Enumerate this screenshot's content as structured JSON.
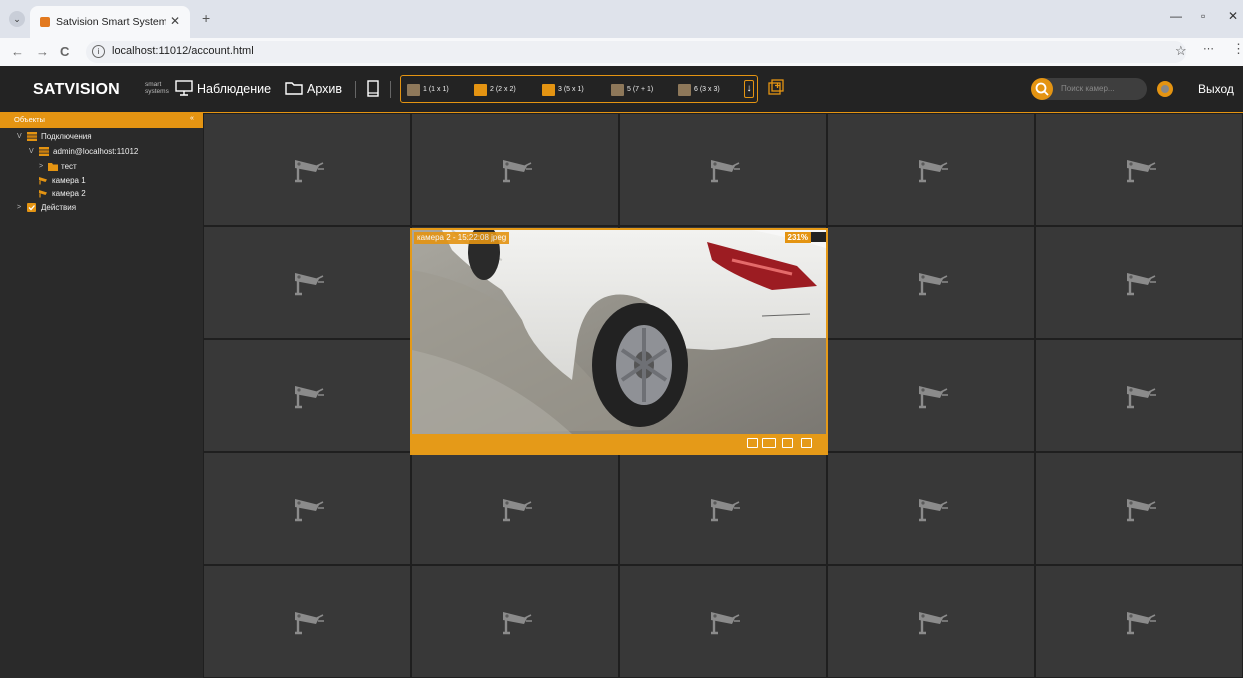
{
  "browser": {
    "tab_title": "Satvision Smart Systems: Наблюдение",
    "tab_close": "✕",
    "new_tab": "+",
    "url": "localhost:11012/account.html",
    "nav": {
      "back": "←",
      "forward": "→",
      "reload": "C"
    },
    "window": {
      "minimize": "—",
      "maximize": "▫",
      "close": "✕"
    }
  },
  "header": {
    "logo": "SATVISION",
    "logo_sub": "smart systems",
    "monitoring_label": "Наблюдение",
    "archive_label": "Архив",
    "layouts": [
      {
        "label": "1 (1 x 1)"
      },
      {
        "label": "2 (2 x 2)"
      },
      {
        "label": "3 (5 x 1)"
      },
      {
        "label": "5 (7 + 1)"
      },
      {
        "label": "6 (3 x 3)"
      }
    ],
    "layout_dropdown": "↓",
    "search_placeholder": "Поиск камер...",
    "logout_label": "Выход"
  },
  "sidebar": {
    "title": "Объекты",
    "collapse": "«",
    "tree": [
      {
        "label": "Подключения",
        "arrow": "V",
        "icon": "connections-icon"
      },
      {
        "label": "admin@localhost:11012",
        "arrow": "V",
        "icon": "server-icon"
      },
      {
        "label": "тест",
        "arrow": ">",
        "icon": "folder-icon"
      },
      {
        "label": "камера 1",
        "arrow": "",
        "icon": "camera-icon"
      },
      {
        "label": "камера 2",
        "arrow": "",
        "icon": "camera-icon"
      },
      {
        "label": "Действия",
        "arrow": ">",
        "icon": "checkbox-icon"
      }
    ]
  },
  "active_camera": {
    "label": "камера 2 - 15:22:08 jpeg",
    "zoom": "231%"
  },
  "grid": {
    "rows": 5,
    "columns": 5
  },
  "colors": {
    "accent": "#e49412",
    "cell": "#383838",
    "header": "#232323"
  }
}
